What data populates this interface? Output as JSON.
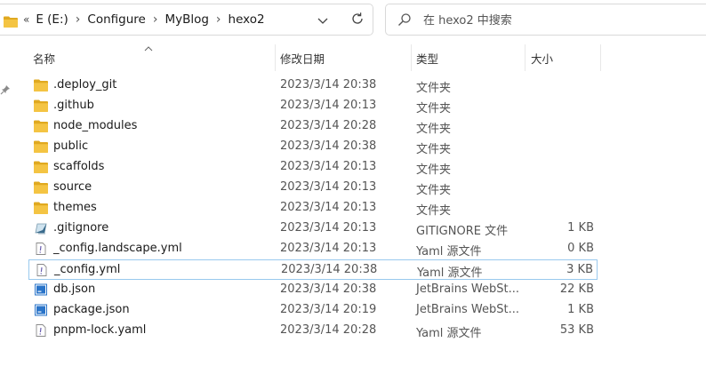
{
  "address": {
    "overflow": "«",
    "crumbs": [
      "E (E:)",
      "Configure",
      "MyBlog",
      "hexo2"
    ]
  },
  "search": {
    "placeholder": "在 hexo2 中搜索"
  },
  "columns": {
    "name": "名称",
    "date": "修改日期",
    "type": "类型",
    "size": "大小"
  },
  "files": [
    {
      "name": ".deploy_git",
      "date": "2023/3/14 20:38",
      "type": "文件夹",
      "size": "",
      "icon": "folder-icon"
    },
    {
      "name": ".github",
      "date": "2023/3/14 20:13",
      "type": "文件夹",
      "size": "",
      "icon": "folder-icon"
    },
    {
      "name": "node_modules",
      "date": "2023/3/14 20:28",
      "type": "文件夹",
      "size": "",
      "icon": "folder-icon"
    },
    {
      "name": "public",
      "date": "2023/3/14 20:38",
      "type": "文件夹",
      "size": "",
      "icon": "folder-icon"
    },
    {
      "name": "scaffolds",
      "date": "2023/3/14 20:13",
      "type": "文件夹",
      "size": "",
      "icon": "folder-icon"
    },
    {
      "name": "source",
      "date": "2023/3/14 20:13",
      "type": "文件夹",
      "size": "",
      "icon": "folder-icon"
    },
    {
      "name": "themes",
      "date": "2023/3/14 20:13",
      "type": "文件夹",
      "size": "",
      "icon": "folder-icon"
    },
    {
      "name": ".gitignore",
      "date": "2023/3/14 20:13",
      "type": "GITIGNORE 文件",
      "size": "1 KB",
      "icon": "gitignore-file-icon"
    },
    {
      "name": "_config.landscape.yml",
      "date": "2023/3/14 20:13",
      "type": "Yaml 源文件",
      "size": "0 KB",
      "icon": "yaml-file-icon"
    },
    {
      "name": "_config.yml",
      "date": "2023/3/14 20:38",
      "type": "Yaml 源文件",
      "size": "3 KB",
      "icon": "yaml-file-icon"
    },
    {
      "name": "db.json",
      "date": "2023/3/14 20:38",
      "type": "JetBrains WebSt...",
      "size": "22 KB",
      "icon": "json-file-icon"
    },
    {
      "name": "package.json",
      "date": "2023/3/14 20:19",
      "type": "JetBrains WebSt...",
      "size": "1 KB",
      "icon": "json-file-icon"
    },
    {
      "name": "pnpm-lock.yaml",
      "date": "2023/3/14 20:28",
      "type": "Yaml 源文件",
      "size": "53 KB",
      "icon": "yaml-file-icon"
    }
  ],
  "selected_index": 9,
  "colors": {
    "folder": "#f4c443",
    "folder_dark": "#e0a920",
    "selection_border": "#99c9ee",
    "json_blue": "#2a74c9"
  }
}
